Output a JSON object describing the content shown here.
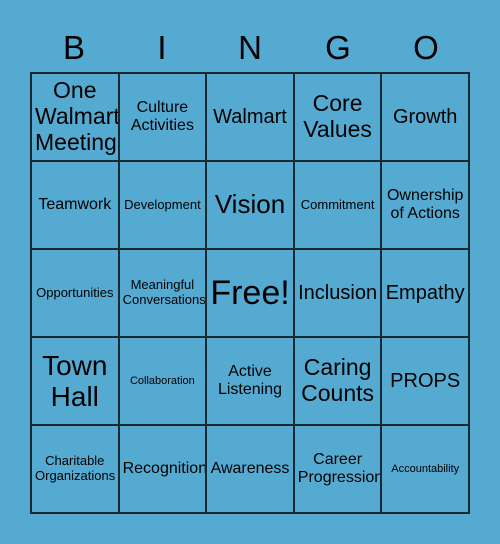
{
  "theme": {
    "background_color": "#55aad2",
    "border_color": "#1a2a33",
    "text_color": "#000000"
  },
  "header": {
    "letters": [
      "B",
      "I",
      "N",
      "G",
      "O"
    ]
  },
  "grid": {
    "columns": 5,
    "rows": 5,
    "free_space": "Free!",
    "cells": [
      {
        "label": "One Walmart Meeting",
        "size": "md"
      },
      {
        "label": "Culture Activities",
        "size": "xs"
      },
      {
        "label": "Walmart",
        "size": "sm"
      },
      {
        "label": "Core Values",
        "size": "md"
      },
      {
        "label": "Growth",
        "size": "sm"
      },
      {
        "label": "Teamwork",
        "size": "xs"
      },
      {
        "label": "Development",
        "size": "xxs"
      },
      {
        "label": "Vision",
        "size": "lg"
      },
      {
        "label": "Commitment",
        "size": "xxs"
      },
      {
        "label": "Ownership of Actions",
        "size": "xs"
      },
      {
        "label": "Opportunities",
        "size": "xxs"
      },
      {
        "label": "Meaningful Conversations",
        "size": "xxs"
      },
      {
        "label": "Free!",
        "size": "xxl"
      },
      {
        "label": "Inclusion",
        "size": "sm"
      },
      {
        "label": "Empathy",
        "size": "sm"
      },
      {
        "label": "Town Hall",
        "size": "xl"
      },
      {
        "label": "Collaboration",
        "size": "tiny"
      },
      {
        "label": "Active Listening",
        "size": "xs"
      },
      {
        "label": "Caring Counts",
        "size": "md"
      },
      {
        "label": "PROPS",
        "size": "sm"
      },
      {
        "label": "Charitable Organizations",
        "size": "xxs"
      },
      {
        "label": "Recognition",
        "size": "xs"
      },
      {
        "label": "Awareness",
        "size": "xs"
      },
      {
        "label": "Career Progression",
        "size": "xs"
      },
      {
        "label": "Accountability",
        "size": "tiny"
      }
    ]
  }
}
